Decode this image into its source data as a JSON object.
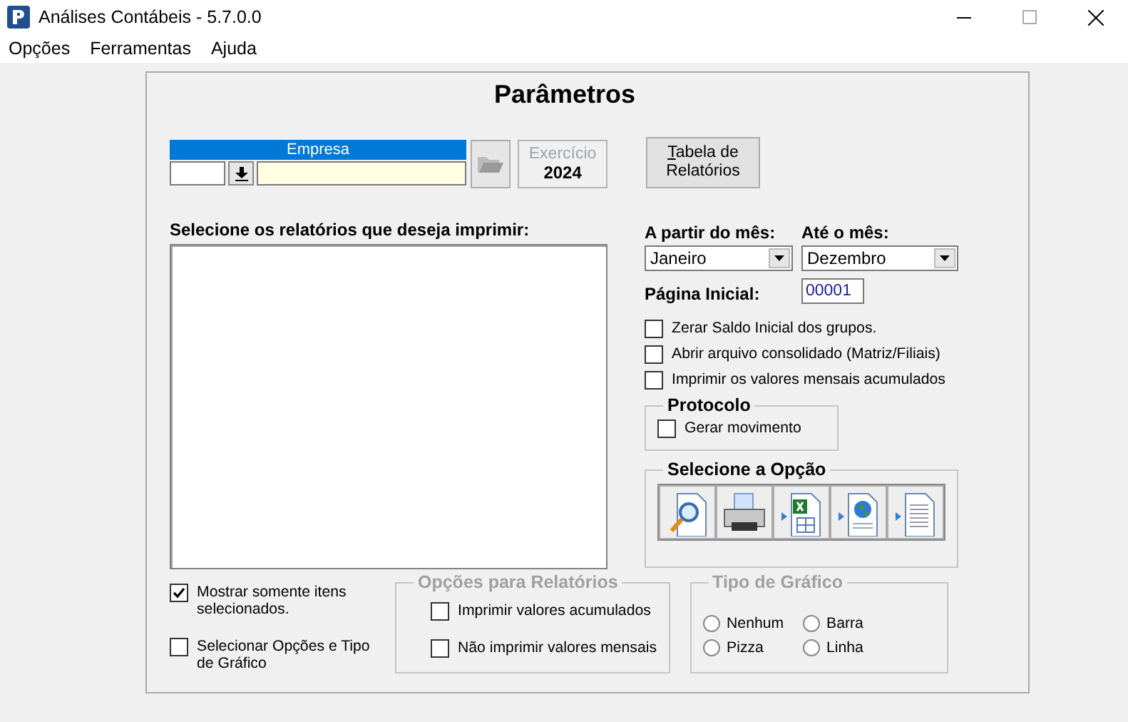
{
  "window": {
    "title": "Análises Contábeis - 5.7.0.0"
  },
  "menu": [
    {
      "label": "Opções"
    },
    {
      "label": "Ferramentas"
    },
    {
      "label": "Ajuda"
    }
  ],
  "panel": {
    "title": "Parâmetros",
    "empresa": {
      "label": "Empresa"
    },
    "exercicio": {
      "label": "Exercício",
      "value": "2024",
      "disabled": true
    },
    "table_button": {
      "label": "Tabela de Relatórios"
    },
    "report_list": {
      "label": "Selecione os relatórios que deseja imprimir:"
    },
    "from_month": {
      "label": "A partir do mês:",
      "value": "Janeiro"
    },
    "to_month": {
      "label": "Até o mês:",
      "value": "Dezembro"
    },
    "start_page": {
      "label": "Página Inicial:",
      "value": "00001"
    },
    "options": [
      {
        "label": "Zerar Saldo Inicial dos grupos.",
        "checked": false
      },
      {
        "label": "Abrir arquivo consolidado (Matriz/Filiais)",
        "checked": false
      },
      {
        "label": "Imprimir os valores mensais acumulados",
        "checked": false
      }
    ],
    "protocol": {
      "title": "Protocolo",
      "options": [
        {
          "label": "Gerar movimento",
          "checked": false
        }
      ]
    },
    "output": {
      "title": "Selecione a Opção",
      "buttons": [
        {
          "kind": "preview"
        },
        {
          "kind": "print"
        },
        {
          "kind": "excel"
        },
        {
          "kind": "web"
        },
        {
          "kind": "text"
        }
      ]
    },
    "list_options": [
      {
        "label": "Mostrar somente itens selecionados.",
        "checked": true
      },
      {
        "label": "Selecionar Opções e Tipo de Gráfico",
        "checked": false
      }
    ],
    "report_options": {
      "title": "Opções para Relatórios",
      "disabled": true,
      "options": [
        {
          "label": "Imprimir valores acumulados",
          "checked": false
        },
        {
          "label": "Não imprimir valores mensais",
          "checked": false
        }
      ]
    },
    "chart_type": {
      "title": "Tipo de Gráfico",
      "disabled": true,
      "options": [
        {
          "label": "Nenhum",
          "selected": false
        },
        {
          "label": "Barra",
          "selected": false
        },
        {
          "label": "Pizza",
          "selected": false
        },
        {
          "label": "Linha",
          "selected": false
        }
      ]
    }
  }
}
